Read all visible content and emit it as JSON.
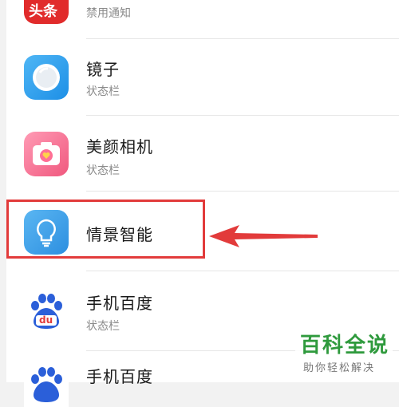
{
  "apps": [
    {
      "name": "",
      "status": "禁用通知",
      "icon": "toutiao-icon"
    },
    {
      "name": "镜子",
      "status": "状态栏",
      "icon": "mirror-icon"
    },
    {
      "name": "美颜相机",
      "status": "状态栏",
      "icon": "beauty-camera-icon"
    },
    {
      "name": "情景智能",
      "status": "",
      "icon": "lightbulb-icon"
    },
    {
      "name": "手机百度",
      "status": "状态栏",
      "icon": "baidu-paw-icon"
    },
    {
      "name": "手机百度",
      "status": "",
      "icon": "baidu-paw-icon"
    }
  ],
  "toutiao_logo_text": "头条",
  "baidu_logo_text": "du",
  "annotation": {
    "highlight_color": "#e23b3b",
    "arrow": "arrow-left"
  },
  "watermark": {
    "title": "百科全说",
    "subtitle": "助你轻松解决"
  }
}
